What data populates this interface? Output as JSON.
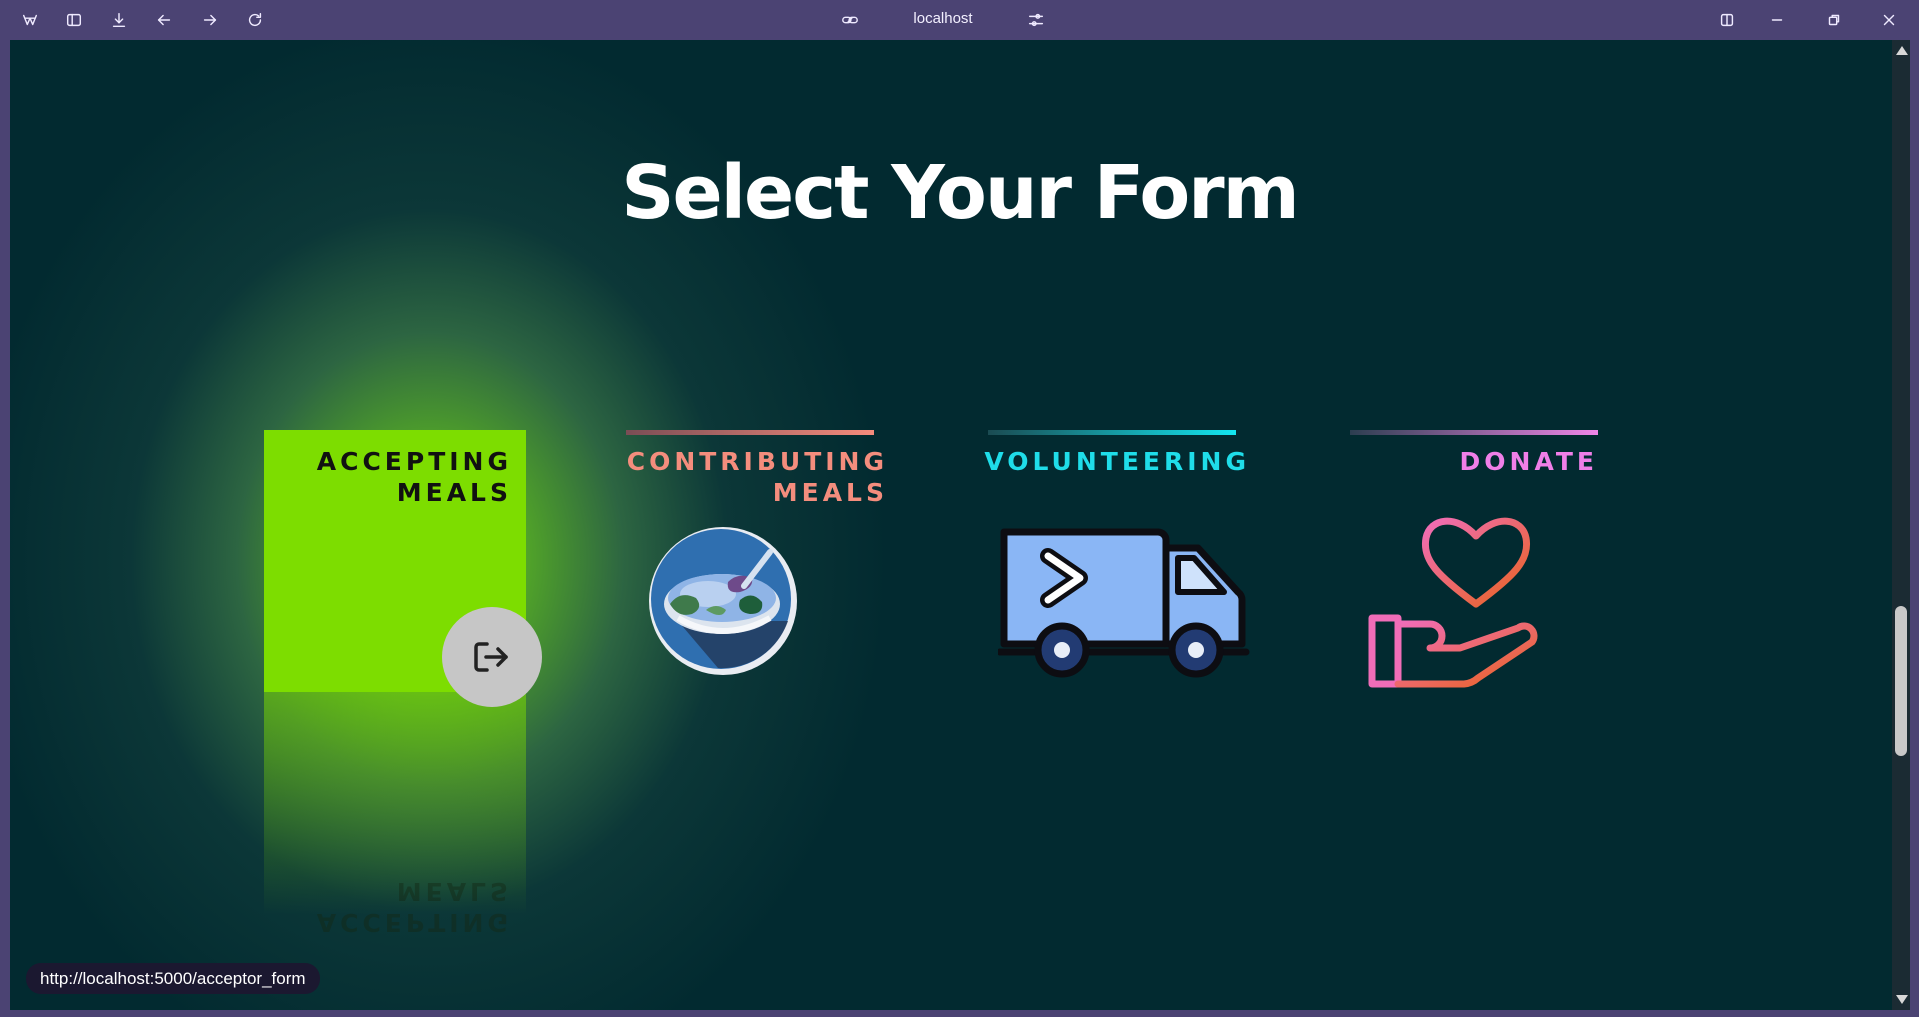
{
  "browser": {
    "address": "localhost",
    "status_url": "http://localhost:5000/acceptor_form"
  },
  "page": {
    "title": "Select Your Form"
  },
  "cards": [
    {
      "label": "ACCEPTING\nMEALS",
      "icon": "enter-icon"
    },
    {
      "label": "CONTRIBUTING\nMEALS",
      "icon": "meal-bowl-icon"
    },
    {
      "label": "VOLUNTEERING",
      "icon": "delivery-van-icon"
    },
    {
      "label": "DONATE",
      "icon": "heart-hand-icon"
    }
  ],
  "colors": {
    "accepting": "#7ddd00",
    "contributing": "#f48d7d",
    "volunteering": "#1fdde9",
    "donate": "#f07fe8",
    "background": "#022a30"
  }
}
